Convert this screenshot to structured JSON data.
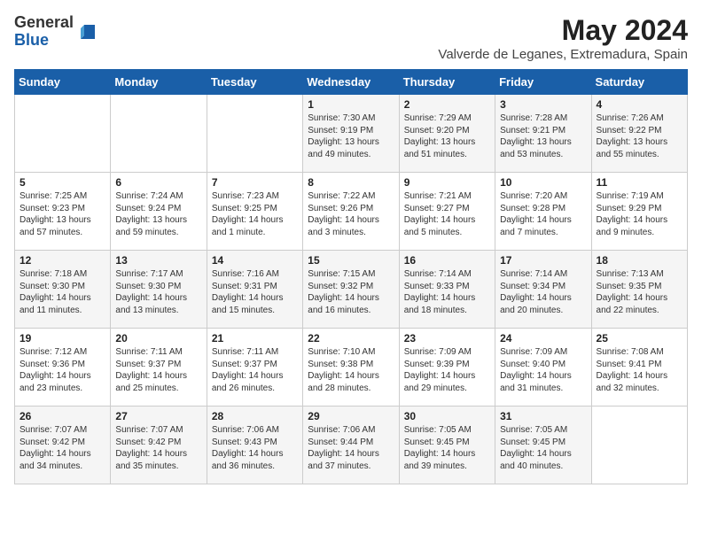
{
  "logo": {
    "general": "General",
    "blue": "Blue"
  },
  "title": {
    "month_year": "May 2024",
    "location": "Valverde de Leganes, Extremadura, Spain"
  },
  "headers": [
    "Sunday",
    "Monday",
    "Tuesday",
    "Wednesday",
    "Thursday",
    "Friday",
    "Saturday"
  ],
  "weeks": [
    [
      {
        "day": "",
        "sunrise": "",
        "sunset": "",
        "daylight": ""
      },
      {
        "day": "",
        "sunrise": "",
        "sunset": "",
        "daylight": ""
      },
      {
        "day": "",
        "sunrise": "",
        "sunset": "",
        "daylight": ""
      },
      {
        "day": "1",
        "sunrise": "Sunrise: 7:30 AM",
        "sunset": "Sunset: 9:19 PM",
        "daylight": "Daylight: 13 hours and 49 minutes."
      },
      {
        "day": "2",
        "sunrise": "Sunrise: 7:29 AM",
        "sunset": "Sunset: 9:20 PM",
        "daylight": "Daylight: 13 hours and 51 minutes."
      },
      {
        "day": "3",
        "sunrise": "Sunrise: 7:28 AM",
        "sunset": "Sunset: 9:21 PM",
        "daylight": "Daylight: 13 hours and 53 minutes."
      },
      {
        "day": "4",
        "sunrise": "Sunrise: 7:26 AM",
        "sunset": "Sunset: 9:22 PM",
        "daylight": "Daylight: 13 hours and 55 minutes."
      }
    ],
    [
      {
        "day": "5",
        "sunrise": "Sunrise: 7:25 AM",
        "sunset": "Sunset: 9:23 PM",
        "daylight": "Daylight: 13 hours and 57 minutes."
      },
      {
        "day": "6",
        "sunrise": "Sunrise: 7:24 AM",
        "sunset": "Sunset: 9:24 PM",
        "daylight": "Daylight: 13 hours and 59 minutes."
      },
      {
        "day": "7",
        "sunrise": "Sunrise: 7:23 AM",
        "sunset": "Sunset: 9:25 PM",
        "daylight": "Daylight: 14 hours and 1 minute."
      },
      {
        "day": "8",
        "sunrise": "Sunrise: 7:22 AM",
        "sunset": "Sunset: 9:26 PM",
        "daylight": "Daylight: 14 hours and 3 minutes."
      },
      {
        "day": "9",
        "sunrise": "Sunrise: 7:21 AM",
        "sunset": "Sunset: 9:27 PM",
        "daylight": "Daylight: 14 hours and 5 minutes."
      },
      {
        "day": "10",
        "sunrise": "Sunrise: 7:20 AM",
        "sunset": "Sunset: 9:28 PM",
        "daylight": "Daylight: 14 hours and 7 minutes."
      },
      {
        "day": "11",
        "sunrise": "Sunrise: 7:19 AM",
        "sunset": "Sunset: 9:29 PM",
        "daylight": "Daylight: 14 hours and 9 minutes."
      }
    ],
    [
      {
        "day": "12",
        "sunrise": "Sunrise: 7:18 AM",
        "sunset": "Sunset: 9:30 PM",
        "daylight": "Daylight: 14 hours and 11 minutes."
      },
      {
        "day": "13",
        "sunrise": "Sunrise: 7:17 AM",
        "sunset": "Sunset: 9:30 PM",
        "daylight": "Daylight: 14 hours and 13 minutes."
      },
      {
        "day": "14",
        "sunrise": "Sunrise: 7:16 AM",
        "sunset": "Sunset: 9:31 PM",
        "daylight": "Daylight: 14 hours and 15 minutes."
      },
      {
        "day": "15",
        "sunrise": "Sunrise: 7:15 AM",
        "sunset": "Sunset: 9:32 PM",
        "daylight": "Daylight: 14 hours and 16 minutes."
      },
      {
        "day": "16",
        "sunrise": "Sunrise: 7:14 AM",
        "sunset": "Sunset: 9:33 PM",
        "daylight": "Daylight: 14 hours and 18 minutes."
      },
      {
        "day": "17",
        "sunrise": "Sunrise: 7:14 AM",
        "sunset": "Sunset: 9:34 PM",
        "daylight": "Daylight: 14 hours and 20 minutes."
      },
      {
        "day": "18",
        "sunrise": "Sunrise: 7:13 AM",
        "sunset": "Sunset: 9:35 PM",
        "daylight": "Daylight: 14 hours and 22 minutes."
      }
    ],
    [
      {
        "day": "19",
        "sunrise": "Sunrise: 7:12 AM",
        "sunset": "Sunset: 9:36 PM",
        "daylight": "Daylight: 14 hours and 23 minutes."
      },
      {
        "day": "20",
        "sunrise": "Sunrise: 7:11 AM",
        "sunset": "Sunset: 9:37 PM",
        "daylight": "Daylight: 14 hours and 25 minutes."
      },
      {
        "day": "21",
        "sunrise": "Sunrise: 7:11 AM",
        "sunset": "Sunset: 9:37 PM",
        "daylight": "Daylight: 14 hours and 26 minutes."
      },
      {
        "day": "22",
        "sunrise": "Sunrise: 7:10 AM",
        "sunset": "Sunset: 9:38 PM",
        "daylight": "Daylight: 14 hours and 28 minutes."
      },
      {
        "day": "23",
        "sunrise": "Sunrise: 7:09 AM",
        "sunset": "Sunset: 9:39 PM",
        "daylight": "Daylight: 14 hours and 29 minutes."
      },
      {
        "day": "24",
        "sunrise": "Sunrise: 7:09 AM",
        "sunset": "Sunset: 9:40 PM",
        "daylight": "Daylight: 14 hours and 31 minutes."
      },
      {
        "day": "25",
        "sunrise": "Sunrise: 7:08 AM",
        "sunset": "Sunset: 9:41 PM",
        "daylight": "Daylight: 14 hours and 32 minutes."
      }
    ],
    [
      {
        "day": "26",
        "sunrise": "Sunrise: 7:07 AM",
        "sunset": "Sunset: 9:42 PM",
        "daylight": "Daylight: 14 hours and 34 minutes."
      },
      {
        "day": "27",
        "sunrise": "Sunrise: 7:07 AM",
        "sunset": "Sunset: 9:42 PM",
        "daylight": "Daylight: 14 hours and 35 minutes."
      },
      {
        "day": "28",
        "sunrise": "Sunrise: 7:06 AM",
        "sunset": "Sunset: 9:43 PM",
        "daylight": "Daylight: 14 hours and 36 minutes."
      },
      {
        "day": "29",
        "sunrise": "Sunrise: 7:06 AM",
        "sunset": "Sunset: 9:44 PM",
        "daylight": "Daylight: 14 hours and 37 minutes."
      },
      {
        "day": "30",
        "sunrise": "Sunrise: 7:05 AM",
        "sunset": "Sunset: 9:45 PM",
        "daylight": "Daylight: 14 hours and 39 minutes."
      },
      {
        "day": "31",
        "sunrise": "Sunrise: 7:05 AM",
        "sunset": "Sunset: 9:45 PM",
        "daylight": "Daylight: 14 hours and 40 minutes."
      },
      {
        "day": "",
        "sunrise": "",
        "sunset": "",
        "daylight": ""
      }
    ]
  ]
}
